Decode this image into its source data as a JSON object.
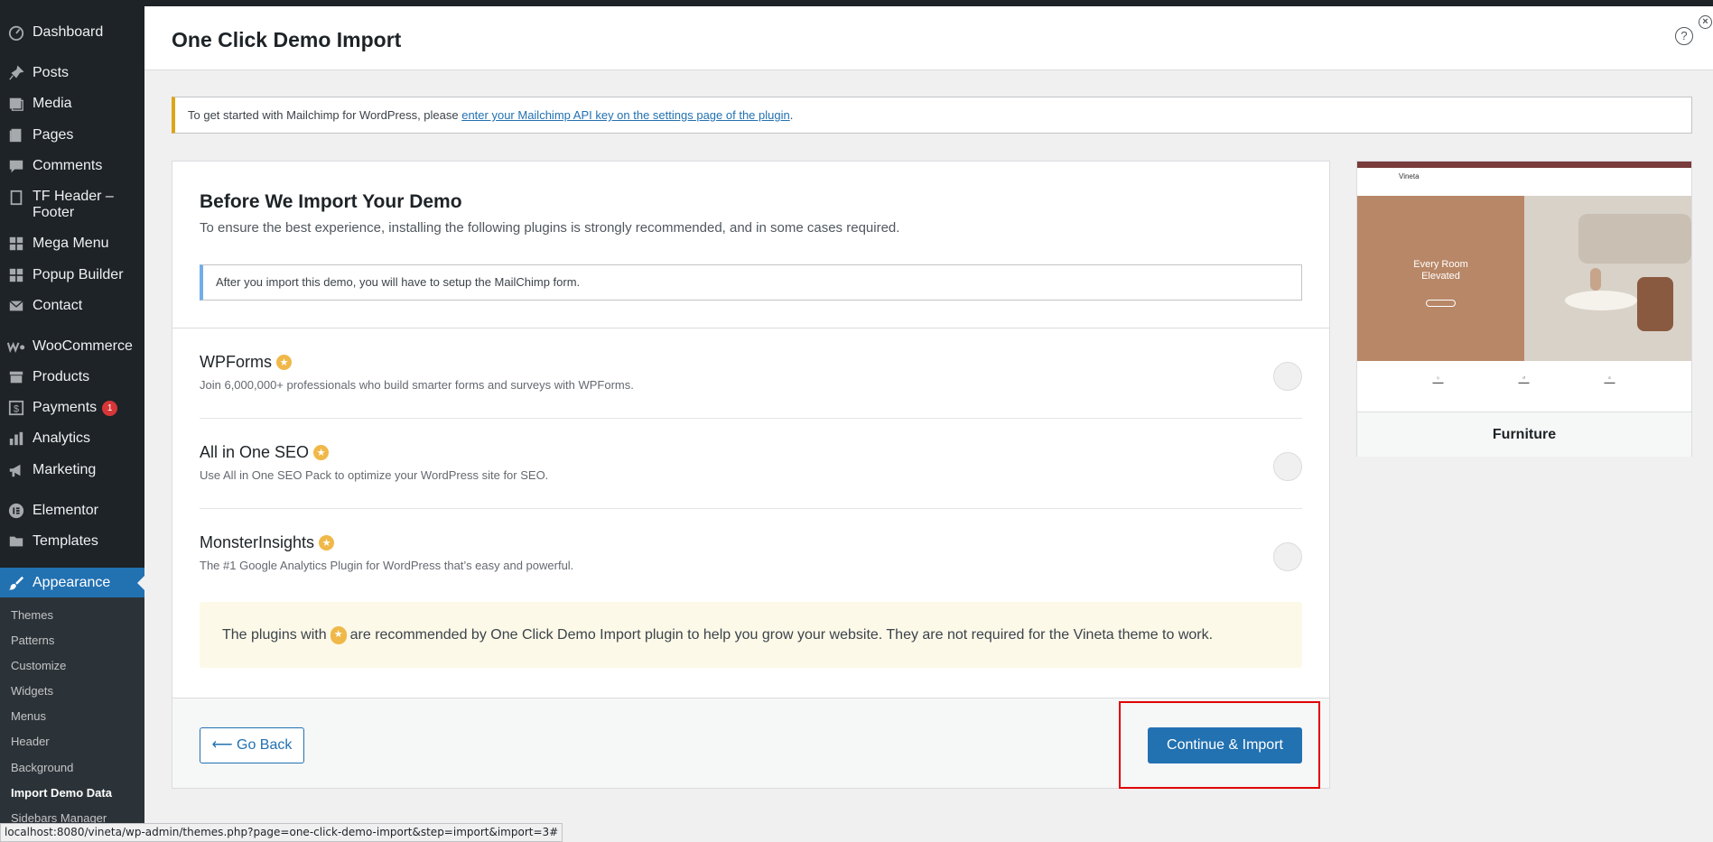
{
  "sidebar": {
    "items": [
      {
        "label": "Dashboard",
        "icon": "dashboard-icon"
      },
      {
        "label": "Posts",
        "icon": "pin-icon"
      },
      {
        "label": "Media",
        "icon": "media-icon"
      },
      {
        "label": "Pages",
        "icon": "pages-icon"
      },
      {
        "label": "Comments",
        "icon": "comment-icon"
      },
      {
        "label": "TF Header – Footer",
        "icon": "document-icon"
      },
      {
        "label": "Mega Menu",
        "icon": "grid-icon"
      },
      {
        "label": "Popup Builder",
        "icon": "grid-icon"
      },
      {
        "label": "Contact",
        "icon": "mail-icon"
      },
      {
        "label": "WooCommerce",
        "icon": "woo-icon"
      },
      {
        "label": "Products",
        "icon": "archive-icon"
      },
      {
        "label": "Payments",
        "icon": "dollar-icon",
        "badge": "1"
      },
      {
        "label": "Analytics",
        "icon": "bar-chart-icon"
      },
      {
        "label": "Marketing",
        "icon": "megaphone-icon"
      },
      {
        "label": "Elementor",
        "icon": "elementor-icon"
      },
      {
        "label": "Templates",
        "icon": "folder-icon"
      },
      {
        "label": "Appearance",
        "icon": "paintbrush-icon"
      }
    ],
    "submenu": [
      "Themes",
      "Patterns",
      "Customize",
      "Widgets",
      "Menus",
      "Header",
      "Background",
      "Import Demo Data",
      "Sidebars Manager"
    ]
  },
  "header": {
    "title": "One Click Demo Import"
  },
  "notice": {
    "text": "To get started with Mailchimp for WordPress, please ",
    "link": "enter your Mailchimp API key on the settings page of the plugin",
    "suffix": "."
  },
  "main": {
    "title": "Before We Import Your Demo",
    "subtitle": "To ensure the best experience, installing the following plugins is strongly recommended, and in some cases required.",
    "info": "After you import this demo, you will have to setup the MailChimp form.",
    "plugins": [
      {
        "name": "WPForms",
        "description": "Join 6,000,000+ professionals who build smarter forms and surveys with WPForms."
      },
      {
        "name": "All in One SEO",
        "description": "Use All in One SEO Pack to optimize your WordPress site for SEO."
      },
      {
        "name": "MonsterInsights",
        "description": "The #1 Google Analytics Plugin for WordPress that’s easy and powerful."
      }
    ],
    "note_before": "The plugins with",
    "note_after": "are recommended by One Click Demo Import plugin to help you grow your website. They are not required for the Vineta theme to work.",
    "back_label": "Go Back",
    "back_arrow": "⟵",
    "import_label": "Continue & Import"
  },
  "preview": {
    "label": "Furniture",
    "logo": "Vineta",
    "hero_line1": "Every Room",
    "hero_line2": "Elevated"
  },
  "statusbar": {
    "url": "localhost:8080/vineta/wp-admin/themes.php?page=one-click-demo-import&step=import&import=3#"
  },
  "colors": {
    "sidebar_bg": "#1d2327",
    "accent": "#2271b1",
    "highlight": "#e00000",
    "star": "#f0b849"
  }
}
